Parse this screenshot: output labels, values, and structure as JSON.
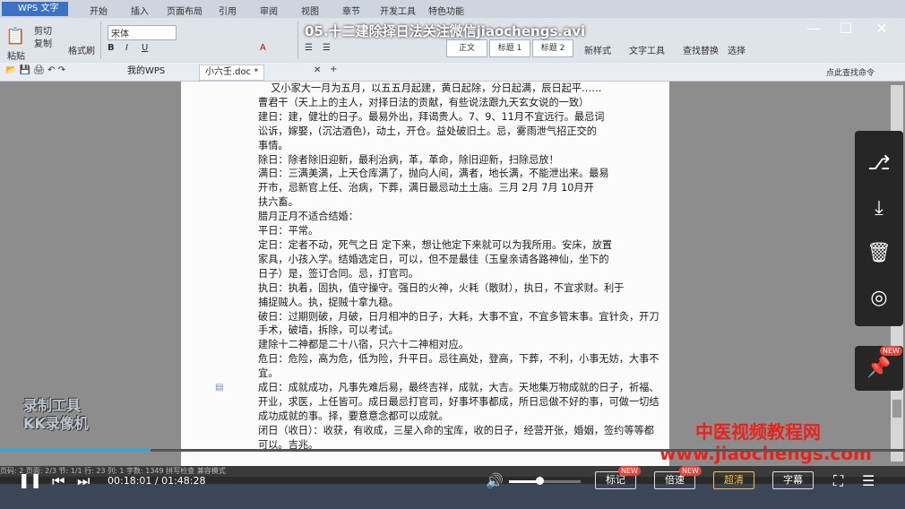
{
  "video_title": "05.十二建除择日法关注微信jiaochengs.avi",
  "menu": [
    "开始",
    "插入",
    "页面布局",
    "引用",
    "审阅",
    "视图",
    "章节",
    "开发工具",
    "特色功能"
  ],
  "app_button": "WPS 文字",
  "ribbon": {
    "paste": "粘贴",
    "cut": "剪切",
    "copy": "复制",
    "format_painter": "格式刷",
    "font_name": "宋体",
    "style_normal": "正文",
    "style_h1": "标题 1",
    "style_h2": "标题 2",
    "new_style": "新样式",
    "text_tools": "文字工具",
    "find_replace": "查找替换",
    "select": "选择"
  },
  "tabs": [
    {
      "label": "我的WPS"
    },
    {
      "label": "小六壬.doc *"
    }
  ],
  "search_hint": "点此查找命令",
  "document_lines": [
    "    又小家大一月为五月，以五五月起建，黄日起除，分日起满，辰日起平……",
    "曹君干（天上上的主人，对择日法的贡献，有些说法跟九天玄女说的一致）",
    "建日：建，健壮的日子。最易外出，拜谒贵人。7、9、11月不宜远行。最忌词",
    "讼诉，嫁娶，(沉沽酒色)，动土，开仓。益处破旧土。忌，雾雨泄气招正交的",
    "事情。",
    "除日：除者除旧迎新，最利治病，革，革命，除旧迎新，扫除忌放！",
    "满日：三满美满，上天仓库满了，抛向人间，满者，地长满，不能泄出来。最易",
    "开市，忌新官上任、治病，下葬，满日最忌动土土庙。三月 2月 7月 10月开",
    "扶六畜。",
    "腊月正月不适合结婚：",
    "平日：平常。",
    "定日：定者不动，死气之日 定下来，想让他定下来就可以为我所用。安床，放置",
    "家具，小孩入学。结婚选定日，可以，但不是最佳（玉皇亲请各路神仙，坐下的",
    "日子）是，签订合同。忌，打官司。",
    "执日：执着，固执，值守操守。强日的火神，火耗（散财），执日，不宜求财。利于",
    "捕捉贼人。执，捉贼十拿九稳。",
    "破日：过期则破，月破，日月相冲的日子，大耗，大事不宜，不宜多管末事。宜针灸，开刀",
    "手术，破墙，拆除，可以考试。",
    "建除十二神都是二十八宿，只六十二神相对应。",
    "危日：危险，高为危，低为险，升平日。忌往高处，登高，下葬，不利，小事无妨，大事不",
    "宜。",
    "成日：成就成功，凡事先难后易，最终吉祥，成就，大吉。天地集万物成就的日子，祈福、",
    "开业，求医，上任皆可。成日最忌打官司，好事坏事都成，所日忌做不好的事，可做一切结",
    "成功成就的事。择，要意意念都可以成就。",
    "闭日（收日）：收获，有收成，三星入命的宝库，收的日子，经营开张，婚姻，签约等等都",
    "可以。吉兆。"
  ],
  "watermark_logo_line1": "录制工具",
  "watermark_logo_line2": "KK录像机",
  "watermark_site_cn": "中医视频教程网",
  "watermark_site_url": "www.jiaochengs.com",
  "player": {
    "time": "00:18:01 / 01:48:28",
    "progress_fraction": 0.166,
    "volume_fraction": 0.42,
    "buttons": [
      {
        "label": "标记",
        "badge": "NEW"
      },
      {
        "label": "倍速",
        "badge": "NEW"
      },
      {
        "label": "超清"
      },
      {
        "label": "字幕"
      }
    ]
  },
  "side_panel_new_badge": "NEW",
  "status_bar": "页码: 2  页面: 2/3  节: 1/1  行: 23  列: 1  字数: 1349  拼写检查  兼容模式",
  "colors": {
    "progress": "#2aa7e8",
    "watermark": "#e8231c",
    "badge": "#e8433a"
  }
}
